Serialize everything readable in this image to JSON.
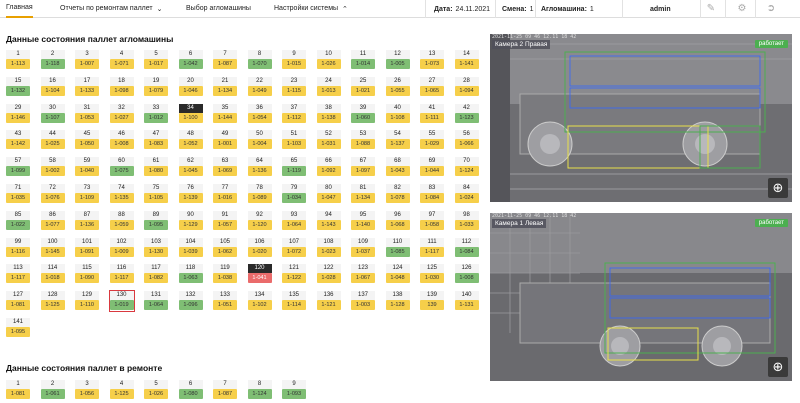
{
  "nav": {
    "tabs": [
      {
        "label": "Главная"
      },
      {
        "label": "Отчеты по ремонтам паллет"
      },
      {
        "label": "Выбор агломашины"
      },
      {
        "label": "Настройки системы"
      }
    ],
    "date_label": "Дата:",
    "date_value": "24.11.2021",
    "shift_label": "Смена:",
    "shift_value": "1",
    "machine_label": "Агломашина:",
    "machine_value": "1",
    "user": "admin"
  },
  "sections": {
    "pallets_title": "Данные состояния паллет агломашины",
    "repair_title": "Данные состояния паллет в ремонте"
  },
  "colors": {
    "yellow": "#f6cf4a",
    "green": "#7fbe74",
    "red": "#ea6b6b",
    "dark": "#2a2a2a",
    "selected_outline": "#d9393f"
  },
  "pallets": [
    {
      "n": "1",
      "s": "1-113",
      "c": "y"
    },
    {
      "n": "2",
      "s": "1-118",
      "c": "g"
    },
    {
      "n": "3",
      "s": "1-007",
      "c": "y"
    },
    {
      "n": "4",
      "s": "1-071",
      "c": "y"
    },
    {
      "n": "5",
      "s": "1-017",
      "c": "y"
    },
    {
      "n": "6",
      "s": "1-042",
      "c": "g"
    },
    {
      "n": "7",
      "s": "1-087",
      "c": "y"
    },
    {
      "n": "8",
      "s": "1-070",
      "c": "g"
    },
    {
      "n": "9",
      "s": "1-015",
      "c": "y"
    },
    {
      "n": "10",
      "s": "1-026",
      "c": "y"
    },
    {
      "n": "11",
      "s": "1-014",
      "c": "g"
    },
    {
      "n": "12",
      "s": "1-005",
      "c": "g"
    },
    {
      "n": "13",
      "s": "1-073",
      "c": "y"
    },
    {
      "n": "14",
      "s": "1-141",
      "c": "y"
    },
    {
      "n": "15",
      "s": "1-132",
      "c": "g"
    },
    {
      "n": "16",
      "s": "1-104",
      "c": "y"
    },
    {
      "n": "17",
      "s": "1-133",
      "c": "y"
    },
    {
      "n": "18",
      "s": "1-098",
      "c": "y"
    },
    {
      "n": "19",
      "s": "1-079",
      "c": "y"
    },
    {
      "n": "20",
      "s": "1-046",
      "c": "y"
    },
    {
      "n": "21",
      "s": "1-134",
      "c": "y"
    },
    {
      "n": "22",
      "s": "1-049",
      "c": "y"
    },
    {
      "n": "23",
      "s": "1-115",
      "c": "y"
    },
    {
      "n": "24",
      "s": "1-013",
      "c": "y"
    },
    {
      "n": "25",
      "s": "1-021",
      "c": "y"
    },
    {
      "n": "26",
      "s": "1-055",
      "c": "y"
    },
    {
      "n": "27",
      "s": "1-065",
      "c": "y"
    },
    {
      "n": "28",
      "s": "1-094",
      "c": "y"
    },
    {
      "n": "29",
      "s": "1-146",
      "c": "y"
    },
    {
      "n": "30",
      "s": "1-107",
      "c": "g"
    },
    {
      "n": "31",
      "s": "1-053",
      "c": "y"
    },
    {
      "n": "32",
      "s": "1-027",
      "c": "y"
    },
    {
      "n": "33",
      "s": "1-012",
      "c": "g"
    },
    {
      "n": "34",
      "s": "1-100",
      "c": "y",
      "dark": true
    },
    {
      "n": "35",
      "s": "1-144",
      "c": "y"
    },
    {
      "n": "36",
      "s": "1-054",
      "c": "y"
    },
    {
      "n": "37",
      "s": "1-112",
      "c": "y"
    },
    {
      "n": "38",
      "s": "1-138",
      "c": "y"
    },
    {
      "n": "39",
      "s": "1-060",
      "c": "g"
    },
    {
      "n": "40",
      "s": "1-108",
      "c": "y"
    },
    {
      "n": "41",
      "s": "1-111",
      "c": "y"
    },
    {
      "n": "42",
      "s": "1-123",
      "c": "g"
    },
    {
      "n": "43",
      "s": "1-142",
      "c": "y"
    },
    {
      "n": "44",
      "s": "1-025",
      "c": "y"
    },
    {
      "n": "45",
      "s": "1-050",
      "c": "y"
    },
    {
      "n": "46",
      "s": "1-008",
      "c": "y"
    },
    {
      "n": "47",
      "s": "1-083",
      "c": "y"
    },
    {
      "n": "48",
      "s": "1-052",
      "c": "y"
    },
    {
      "n": "49",
      "s": "1-001",
      "c": "y"
    },
    {
      "n": "50",
      "s": "1-004",
      "c": "y"
    },
    {
      "n": "51",
      "s": "1-103",
      "c": "y"
    },
    {
      "n": "52",
      "s": "1-031",
      "c": "y"
    },
    {
      "n": "53",
      "s": "1-088",
      "c": "y"
    },
    {
      "n": "54",
      "s": "1-137",
      "c": "y"
    },
    {
      "n": "55",
      "s": "1-029",
      "c": "y"
    },
    {
      "n": "56",
      "s": "1-066",
      "c": "y"
    },
    {
      "n": "57",
      "s": "1-099",
      "c": "g"
    },
    {
      "n": "58",
      "s": "1-002",
      "c": "y"
    },
    {
      "n": "59",
      "s": "1-040",
      "c": "y"
    },
    {
      "n": "60",
      "s": "1-075",
      "c": "g"
    },
    {
      "n": "61",
      "s": "1-080",
      "c": "y"
    },
    {
      "n": "62",
      "s": "1-045",
      "c": "y"
    },
    {
      "n": "63",
      "s": "1-069",
      "c": "y"
    },
    {
      "n": "64",
      "s": "1-136",
      "c": "y"
    },
    {
      "n": "65",
      "s": "1-119",
      "c": "g"
    },
    {
      "n": "66",
      "s": "1-092",
      "c": "y"
    },
    {
      "n": "67",
      "s": "1-097",
      "c": "y"
    },
    {
      "n": "68",
      "s": "1-043",
      "c": "y"
    },
    {
      "n": "69",
      "s": "1-044",
      "c": "y"
    },
    {
      "n": "70",
      "s": "1-124",
      "c": "y"
    },
    {
      "n": "71",
      "s": "1-035",
      "c": "y"
    },
    {
      "n": "72",
      "s": "1-076",
      "c": "y"
    },
    {
      "n": "73",
      "s": "1-109",
      "c": "y"
    },
    {
      "n": "74",
      "s": "1-135",
      "c": "y"
    },
    {
      "n": "75",
      "s": "1-105",
      "c": "y"
    },
    {
      "n": "76",
      "s": "1-139",
      "c": "y"
    },
    {
      "n": "77",
      "s": "1-016",
      "c": "y"
    },
    {
      "n": "78",
      "s": "1-089",
      "c": "y"
    },
    {
      "n": "79",
      "s": "1-034",
      "c": "g"
    },
    {
      "n": "80",
      "s": "1-047",
      "c": "y"
    },
    {
      "n": "81",
      "s": "1-134",
      "c": "y"
    },
    {
      "n": "82",
      "s": "1-078",
      "c": "y"
    },
    {
      "n": "83",
      "s": "1-084",
      "c": "y"
    },
    {
      "n": "84",
      "s": "1-024",
      "c": "y"
    },
    {
      "n": "85",
      "s": "1-022",
      "c": "g"
    },
    {
      "n": "86",
      "s": "1-077",
      "c": "y"
    },
    {
      "n": "87",
      "s": "1-136",
      "c": "y"
    },
    {
      "n": "88",
      "s": "1-059",
      "c": "y"
    },
    {
      "n": "89",
      "s": "1-095",
      "c": "g"
    },
    {
      "n": "90",
      "s": "1-129",
      "c": "y"
    },
    {
      "n": "91",
      "s": "1-057",
      "c": "y"
    },
    {
      "n": "92",
      "s": "1-120",
      "c": "y"
    },
    {
      "n": "93",
      "s": "1-064",
      "c": "y"
    },
    {
      "n": "94",
      "s": "1-143",
      "c": "y"
    },
    {
      "n": "95",
      "s": "1-140",
      "c": "y"
    },
    {
      "n": "96",
      "s": "1-068",
      "c": "y"
    },
    {
      "n": "97",
      "s": "1-058",
      "c": "y"
    },
    {
      "n": "98",
      "s": "1-033",
      "c": "y"
    },
    {
      "n": "99",
      "s": "1-116",
      "c": "y"
    },
    {
      "n": "100",
      "s": "1-145",
      "c": "y"
    },
    {
      "n": "101",
      "s": "1-091",
      "c": "y"
    },
    {
      "n": "102",
      "s": "1-009",
      "c": "y"
    },
    {
      "n": "103",
      "s": "1-130",
      "c": "y"
    },
    {
      "n": "104",
      "s": "1-039",
      "c": "y"
    },
    {
      "n": "105",
      "s": "1-062",
      "c": "y"
    },
    {
      "n": "106",
      "s": "1-020",
      "c": "y"
    },
    {
      "n": "107",
      "s": "1-072",
      "c": "y"
    },
    {
      "n": "108",
      "s": "1-023",
      "c": "y"
    },
    {
      "n": "109",
      "s": "1-037",
      "c": "y"
    },
    {
      "n": "110",
      "s": "1-085",
      "c": "g"
    },
    {
      "n": "111",
      "s": "1-117",
      "c": "y"
    },
    {
      "n": "112",
      "s": "1-084",
      "c": "g"
    },
    {
      "n": "113",
      "s": "1-117",
      "c": "y"
    },
    {
      "n": "114",
      "s": "1-018",
      "c": "y"
    },
    {
      "n": "115",
      "s": "1-090",
      "c": "y"
    },
    {
      "n": "116",
      "s": "1-117",
      "c": "y"
    },
    {
      "n": "117",
      "s": "1-082",
      "c": "y"
    },
    {
      "n": "118",
      "s": "1-063",
      "c": "g"
    },
    {
      "n": "119",
      "s": "1-038",
      "c": "y"
    },
    {
      "n": "120",
      "s": "1-041",
      "c": "r",
      "dark": true
    },
    {
      "n": "121",
      "s": "1-122",
      "c": "y"
    },
    {
      "n": "122",
      "s": "1-028",
      "c": "y"
    },
    {
      "n": "123",
      "s": "1-067",
      "c": "y"
    },
    {
      "n": "124",
      "s": "1-048",
      "c": "y"
    },
    {
      "n": "125",
      "s": "1-030",
      "c": "y"
    },
    {
      "n": "126",
      "s": "1-008",
      "c": "g"
    },
    {
      "n": "127",
      "s": "1-081",
      "c": "y"
    },
    {
      "n": "128",
      "s": "1-125",
      "c": "y"
    },
    {
      "n": "129",
      "s": "1-110",
      "c": "y"
    },
    {
      "n": "130",
      "s": "1-019",
      "c": "g",
      "selected": true
    },
    {
      "n": "131",
      "s": "1-064",
      "c": "g"
    },
    {
      "n": "132",
      "s": "1-096",
      "c": "g"
    },
    {
      "n": "133",
      "s": "1-051",
      "c": "y"
    },
    {
      "n": "134",
      "s": "1-102",
      "c": "y"
    },
    {
      "n": "135",
      "s": "1-114",
      "c": "y"
    },
    {
      "n": "136",
      "s": "1-121",
      "c": "y"
    },
    {
      "n": "137",
      "s": "1-003",
      "c": "y"
    },
    {
      "n": "138",
      "s": "1-128",
      "c": "y"
    },
    {
      "n": "139",
      "s": "139",
      "c": "y"
    },
    {
      "n": "140",
      "s": "1-131",
      "c": "y"
    },
    {
      "n": "141",
      "s": "1-095",
      "c": "y"
    }
  ],
  "repair": [
    {
      "n": "1",
      "s": "1-081",
      "c": "y"
    },
    {
      "n": "2",
      "s": "1-061",
      "c": "g"
    },
    {
      "n": "3",
      "s": "1-056",
      "c": "y"
    },
    {
      "n": "4",
      "s": "1-125",
      "c": "y"
    },
    {
      "n": "5",
      "s": "1-026",
      "c": "y"
    },
    {
      "n": "6",
      "s": "1-080",
      "c": "g"
    },
    {
      "n": "7",
      "s": "1-087",
      "c": "y"
    },
    {
      "n": "8",
      "s": "1-124",
      "c": "g"
    },
    {
      "n": "9",
      "s": "1-093",
      "c": "g"
    }
  ],
  "cameras": [
    {
      "label": "Камера 2 Правая",
      "status": "работает",
      "stamp": "2021-11-25 09 46 12.11 18 42"
    },
    {
      "label": "Камера 1 Левая",
      "status": "работает",
      "stamp": "2021-11-25 09 46 12.11 18 42"
    }
  ]
}
